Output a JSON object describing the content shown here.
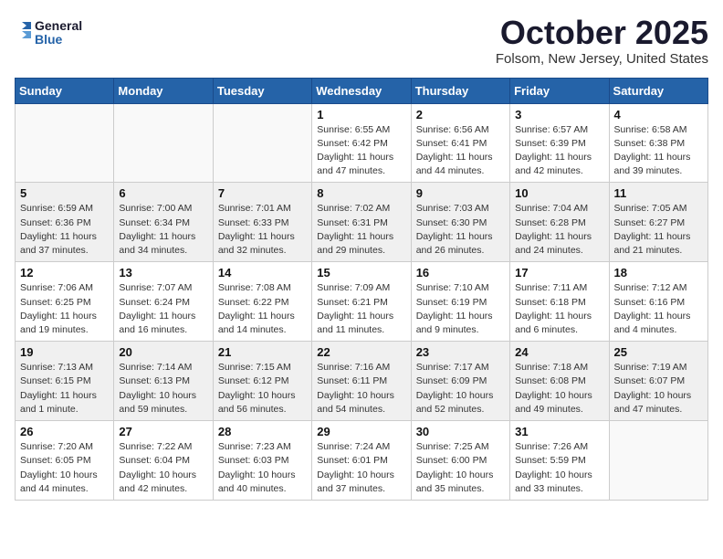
{
  "logo": {
    "line1": "General",
    "line2": "Blue"
  },
  "title": "October 2025",
  "location": "Folsom, New Jersey, United States",
  "days_of_week": [
    "Sunday",
    "Monday",
    "Tuesday",
    "Wednesday",
    "Thursday",
    "Friday",
    "Saturday"
  ],
  "weeks": [
    [
      {
        "day": "",
        "info": ""
      },
      {
        "day": "",
        "info": ""
      },
      {
        "day": "",
        "info": ""
      },
      {
        "day": "1",
        "info": "Sunrise: 6:55 AM\nSunset: 6:42 PM\nDaylight: 11 hours and 47 minutes."
      },
      {
        "day": "2",
        "info": "Sunrise: 6:56 AM\nSunset: 6:41 PM\nDaylight: 11 hours and 44 minutes."
      },
      {
        "day": "3",
        "info": "Sunrise: 6:57 AM\nSunset: 6:39 PM\nDaylight: 11 hours and 42 minutes."
      },
      {
        "day": "4",
        "info": "Sunrise: 6:58 AM\nSunset: 6:38 PM\nDaylight: 11 hours and 39 minutes."
      }
    ],
    [
      {
        "day": "5",
        "info": "Sunrise: 6:59 AM\nSunset: 6:36 PM\nDaylight: 11 hours and 37 minutes."
      },
      {
        "day": "6",
        "info": "Sunrise: 7:00 AM\nSunset: 6:34 PM\nDaylight: 11 hours and 34 minutes."
      },
      {
        "day": "7",
        "info": "Sunrise: 7:01 AM\nSunset: 6:33 PM\nDaylight: 11 hours and 32 minutes."
      },
      {
        "day": "8",
        "info": "Sunrise: 7:02 AM\nSunset: 6:31 PM\nDaylight: 11 hours and 29 minutes."
      },
      {
        "day": "9",
        "info": "Sunrise: 7:03 AM\nSunset: 6:30 PM\nDaylight: 11 hours and 26 minutes."
      },
      {
        "day": "10",
        "info": "Sunrise: 7:04 AM\nSunset: 6:28 PM\nDaylight: 11 hours and 24 minutes."
      },
      {
        "day": "11",
        "info": "Sunrise: 7:05 AM\nSunset: 6:27 PM\nDaylight: 11 hours and 21 minutes."
      }
    ],
    [
      {
        "day": "12",
        "info": "Sunrise: 7:06 AM\nSunset: 6:25 PM\nDaylight: 11 hours and 19 minutes."
      },
      {
        "day": "13",
        "info": "Sunrise: 7:07 AM\nSunset: 6:24 PM\nDaylight: 11 hours and 16 minutes."
      },
      {
        "day": "14",
        "info": "Sunrise: 7:08 AM\nSunset: 6:22 PM\nDaylight: 11 hours and 14 minutes."
      },
      {
        "day": "15",
        "info": "Sunrise: 7:09 AM\nSunset: 6:21 PM\nDaylight: 11 hours and 11 minutes."
      },
      {
        "day": "16",
        "info": "Sunrise: 7:10 AM\nSunset: 6:19 PM\nDaylight: 11 hours and 9 minutes."
      },
      {
        "day": "17",
        "info": "Sunrise: 7:11 AM\nSunset: 6:18 PM\nDaylight: 11 hours and 6 minutes."
      },
      {
        "day": "18",
        "info": "Sunrise: 7:12 AM\nSunset: 6:16 PM\nDaylight: 11 hours and 4 minutes."
      }
    ],
    [
      {
        "day": "19",
        "info": "Sunrise: 7:13 AM\nSunset: 6:15 PM\nDaylight: 11 hours and 1 minute."
      },
      {
        "day": "20",
        "info": "Sunrise: 7:14 AM\nSunset: 6:13 PM\nDaylight: 10 hours and 59 minutes."
      },
      {
        "day": "21",
        "info": "Sunrise: 7:15 AM\nSunset: 6:12 PM\nDaylight: 10 hours and 56 minutes."
      },
      {
        "day": "22",
        "info": "Sunrise: 7:16 AM\nSunset: 6:11 PM\nDaylight: 10 hours and 54 minutes."
      },
      {
        "day": "23",
        "info": "Sunrise: 7:17 AM\nSunset: 6:09 PM\nDaylight: 10 hours and 52 minutes."
      },
      {
        "day": "24",
        "info": "Sunrise: 7:18 AM\nSunset: 6:08 PM\nDaylight: 10 hours and 49 minutes."
      },
      {
        "day": "25",
        "info": "Sunrise: 7:19 AM\nSunset: 6:07 PM\nDaylight: 10 hours and 47 minutes."
      }
    ],
    [
      {
        "day": "26",
        "info": "Sunrise: 7:20 AM\nSunset: 6:05 PM\nDaylight: 10 hours and 44 minutes."
      },
      {
        "day": "27",
        "info": "Sunrise: 7:22 AM\nSunset: 6:04 PM\nDaylight: 10 hours and 42 minutes."
      },
      {
        "day": "28",
        "info": "Sunrise: 7:23 AM\nSunset: 6:03 PM\nDaylight: 10 hours and 40 minutes."
      },
      {
        "day": "29",
        "info": "Sunrise: 7:24 AM\nSunset: 6:01 PM\nDaylight: 10 hours and 37 minutes."
      },
      {
        "day": "30",
        "info": "Sunrise: 7:25 AM\nSunset: 6:00 PM\nDaylight: 10 hours and 35 minutes."
      },
      {
        "day": "31",
        "info": "Sunrise: 7:26 AM\nSunset: 5:59 PM\nDaylight: 10 hours and 33 minutes."
      },
      {
        "day": "",
        "info": ""
      }
    ]
  ]
}
